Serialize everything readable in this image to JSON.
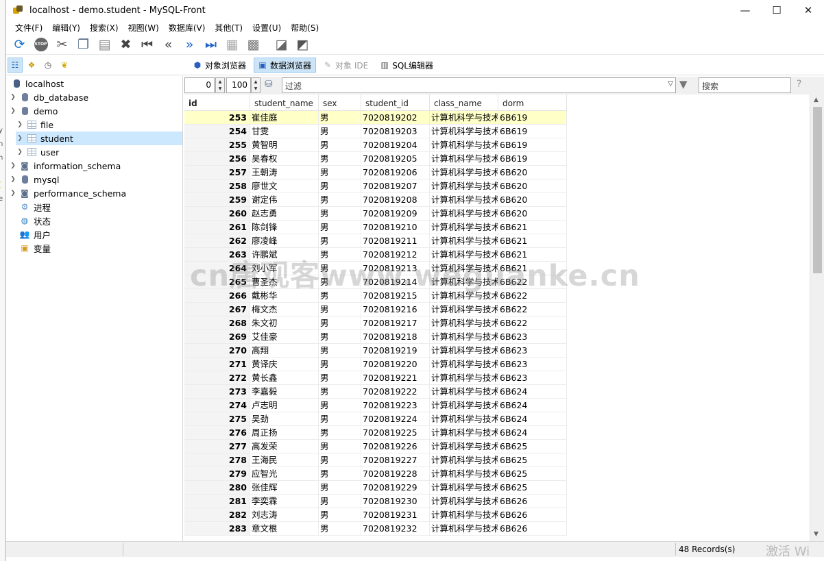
{
  "window": {
    "title": "localhost - demo.student - MySQL-Front"
  },
  "menu": [
    "文件(F)",
    "编辑(Y)",
    "搜索(X)",
    "视图(W)",
    "数据库(V)",
    "其他(T)",
    "设置(U)",
    "帮助(S)"
  ],
  "views": [
    {
      "label": "对象浏览器",
      "state": "normal"
    },
    {
      "label": "数据浏览器",
      "state": "active"
    },
    {
      "label": "对象 IDE",
      "state": "disabled"
    },
    {
      "label": "SQL编辑器",
      "state": "normal"
    }
  ],
  "tree": {
    "server": "localhost",
    "databases": [
      "db_database",
      "demo"
    ],
    "tables": [
      "file",
      "student",
      "user"
    ],
    "schemas": [
      "information_schema",
      "mysql",
      "performance_schema"
    ],
    "extras": [
      "进程",
      "状态",
      "用户",
      "变量"
    ]
  },
  "filter": {
    "offset": "0",
    "limit": "100",
    "placeholder": "过滤",
    "search_placeholder": "搜索"
  },
  "columns": [
    "id",
    "student_name",
    "sex",
    "student_id",
    "class_name",
    "dorm"
  ],
  "rows": [
    [
      "253",
      "崔佳庭",
      "男",
      "7020819202",
      "计算机科学与技术",
      "6B619"
    ],
    [
      "254",
      "甘雯",
      "男",
      "7020819203",
      "计算机科学与技术",
      "6B619"
    ],
    [
      "255",
      "黄智明",
      "男",
      "7020819204",
      "计算机科学与技术",
      "6B619"
    ],
    [
      "256",
      "吴春权",
      "男",
      "7020819205",
      "计算机科学与技术",
      "6B619"
    ],
    [
      "257",
      "王朝涛",
      "男",
      "7020819206",
      "计算机科学与技术",
      "6B620"
    ],
    [
      "258",
      "廖世文",
      "男",
      "7020819207",
      "计算机科学与技术",
      "6B620"
    ],
    [
      "259",
      "谢定伟",
      "男",
      "7020819208",
      "计算机科学与技术",
      "6B620"
    ],
    [
      "260",
      "赵志勇",
      "男",
      "7020819209",
      "计算机科学与技术",
      "6B620"
    ],
    [
      "261",
      "陈剑锋",
      "男",
      "7020819210",
      "计算机科学与技术",
      "6B621"
    ],
    [
      "262",
      "廖凌峰",
      "男",
      "7020819211",
      "计算机科学与技术",
      "6B621"
    ],
    [
      "263",
      "许鹏斌",
      "男",
      "7020819212",
      "计算机科学与技术",
      "6B621"
    ],
    [
      "264",
      "刘小军",
      "男",
      "7020819213",
      "计算机科学与技术",
      "6B621"
    ],
    [
      "265",
      "曹圣杰",
      "男",
      "7020819214",
      "计算机科学与技术",
      "6B622"
    ],
    [
      "266",
      "戴彬华",
      "男",
      "7020819215",
      "计算机科学与技术",
      "6B622"
    ],
    [
      "267",
      "梅文杰",
      "男",
      "7020819216",
      "计算机科学与技术",
      "6B622"
    ],
    [
      "268",
      "朱文初",
      "男",
      "7020819217",
      "计算机科学与技术",
      "6B622"
    ],
    [
      "269",
      "艾佳豪",
      "男",
      "7020819218",
      "计算机科学与技术",
      "6B623"
    ],
    [
      "270",
      "高翔",
      "男",
      "7020819219",
      "计算机科学与技术",
      "6B623"
    ],
    [
      "271",
      "黄译庆",
      "男",
      "7020819220",
      "计算机科学与技术",
      "6B623"
    ],
    [
      "272",
      "黄长鑫",
      "男",
      "7020819221",
      "计算机科学与技术",
      "6B623"
    ],
    [
      "273",
      "李嘉毅",
      "男",
      "7020819222",
      "计算机科学与技术",
      "6B624"
    ],
    [
      "274",
      "卢志明",
      "男",
      "7020819223",
      "计算机科学与技术",
      "6B624"
    ],
    [
      "275",
      "吴劲",
      "男",
      "7020819224",
      "计算机科学与技术",
      "6B624"
    ],
    [
      "276",
      "周正扬",
      "男",
      "7020819225",
      "计算机科学与技术",
      "6B624"
    ],
    [
      "277",
      "高发荣",
      "男",
      "7020819226",
      "计算机科学与技术",
      "6B625"
    ],
    [
      "278",
      "王海民",
      "男",
      "7020819227",
      "计算机科学与技术",
      "6B625"
    ],
    [
      "279",
      "应智光",
      "男",
      "7020819228",
      "计算机科学与技术",
      "6B625"
    ],
    [
      "280",
      "张佳辉",
      "男",
      "7020819229",
      "计算机科学与技术",
      "6B625"
    ],
    [
      "281",
      "李奕霖",
      "男",
      "7020819230",
      "计算机科学与技术",
      "6B626"
    ],
    [
      "282",
      "刘志涛",
      "男",
      "7020819231",
      "计算机科学与技术",
      "6B626"
    ],
    [
      "283",
      "章文根",
      "男",
      "7020819232",
      "计算机科学与技术",
      "6B626"
    ]
  ],
  "status": {
    "records": "48 Records(s)"
  },
  "overlay": {
    "watermark": "cn唐观客www.weguanke.cn",
    "activate": "激活 Wi"
  }
}
